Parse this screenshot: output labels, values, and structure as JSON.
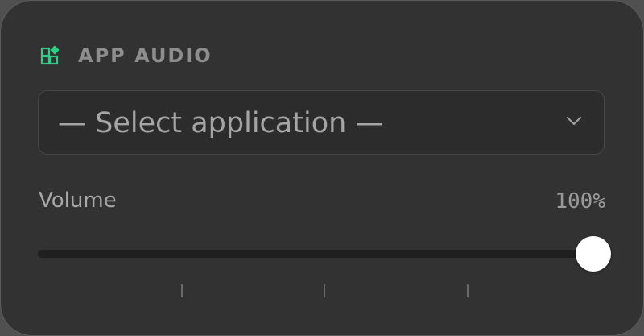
{
  "section": {
    "title": "APP AUDIO",
    "icon": "app-audio-icon",
    "accent_color": "#2ecf86"
  },
  "app_select": {
    "value": "— Select application —",
    "chevron_icon": "chevron-down-icon"
  },
  "volume": {
    "label": "Volume",
    "value_text": "100%",
    "level": 1.0,
    "tick_count": 3
  }
}
